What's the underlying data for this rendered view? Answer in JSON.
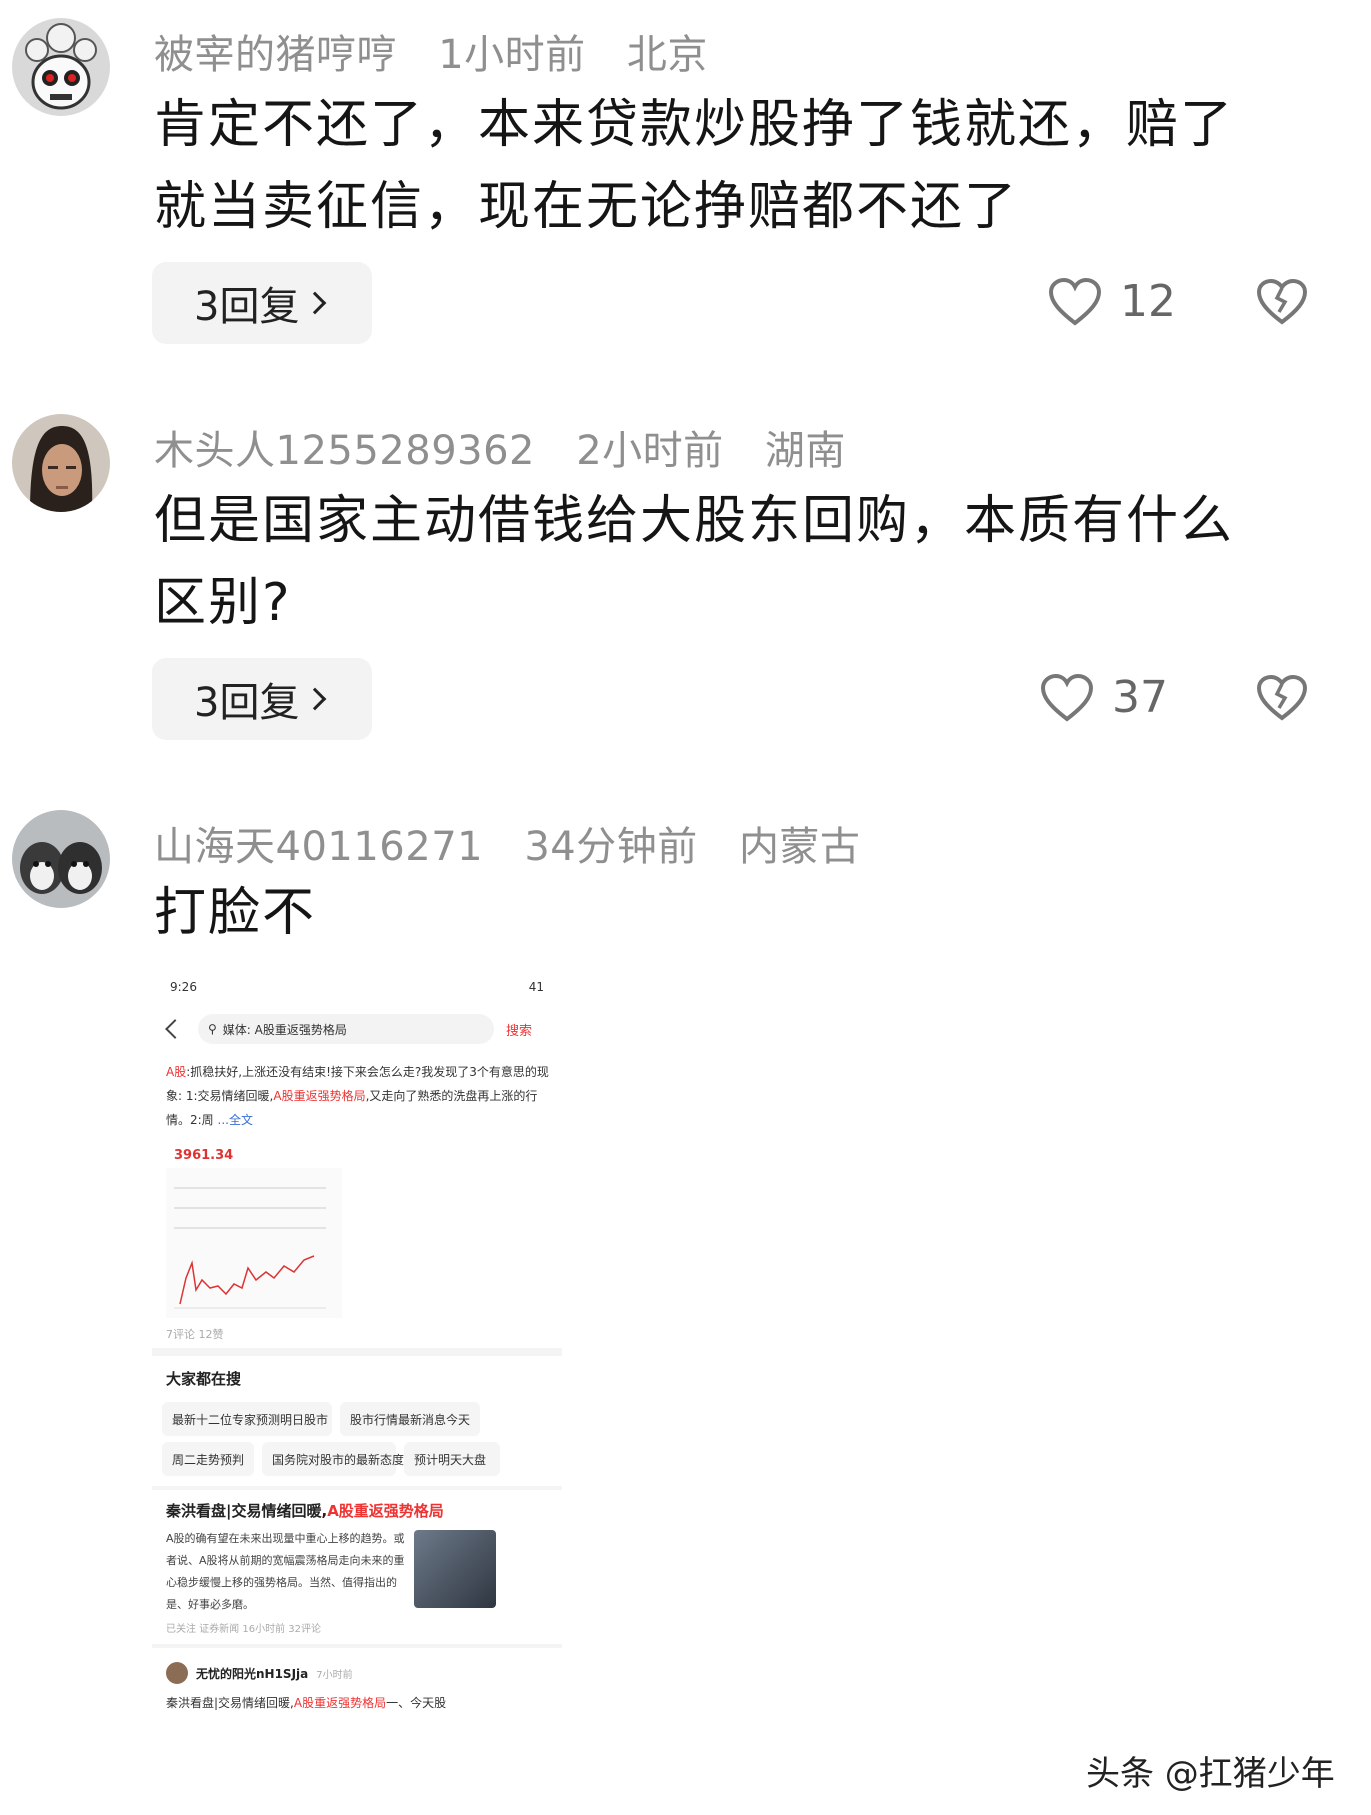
{
  "comments": [
    {
      "username": "被宰的猪哼哼",
      "time": "1小时前",
      "location": "北京",
      "text_line1": "肯定不还了，本来贷款炒股挣了钱就还，赔了",
      "text_line2": "就当卖征信，现在无论挣赔都不还了",
      "reply_label": "3回复",
      "likes": "12"
    },
    {
      "username": "木头人1255289362",
      "time": "2小时前",
      "location": "湖南",
      "text_line1": "但是国家主动借钱给大股东回购，本质有什么",
      "text_line2": "区别?",
      "reply_label": "3回复",
      "likes": "37"
    },
    {
      "username": "山海天40116271",
      "time": "34分钟前",
      "location": "内蒙古",
      "text_line1": "打脸不"
    }
  ],
  "screenshot": {
    "status_time": "9:26",
    "battery": "41",
    "search_query": "媒体: A股重返强势格局",
    "search_button": "搜索",
    "snippet_a": "A股",
    "snippet_1": ":抓稳扶好,上涨还没有结束!接下来会怎么走?我发现了3个有意思的现象: 1:交易情绪回暖,",
    "snippet_red": "A股重返强势格局",
    "snippet_2": ",又走向了熟悉的洗盘再上涨的行情。2:周",
    "snippet_more": "...全文",
    "index_value": "3961.34",
    "post_meta": "7评论  12赞",
    "trending_title": "大家都在搜",
    "chips": [
      "最新十二位专家预测明日股市",
      "股市行情最新消息今天",
      "周二走势预判",
      "国务院对股市的最新态度",
      "预计明天大盘"
    ],
    "news_title_a": "秦洪看盘|交易情绪回暖,",
    "news_title_b": "A股重返强势格局",
    "news_body": "A股的确有望在未来出现量中重心上移的趋势。或者说、A股将从前期的宽幅震荡格局走向未来的重心稳步缓慢上移的强势格局。当然、值得指出的是、好事必多磨。",
    "news_meta": "已关注  证券新闻  16小时前  32评论",
    "user_name": "无忧的阳光nH1SJja",
    "user_time": "7小时前",
    "user_text_a": "秦洪看盘|交易情绪回暖,",
    "user_text_red": "A股重返强势格局",
    "user_text_b": "一、今天股"
  },
  "watermark": "头条 @扛猪少年",
  "colors": {
    "meta": "#8f8f8f",
    "accent_red": "#e33333",
    "reply_bg": "#f3f3f3"
  }
}
